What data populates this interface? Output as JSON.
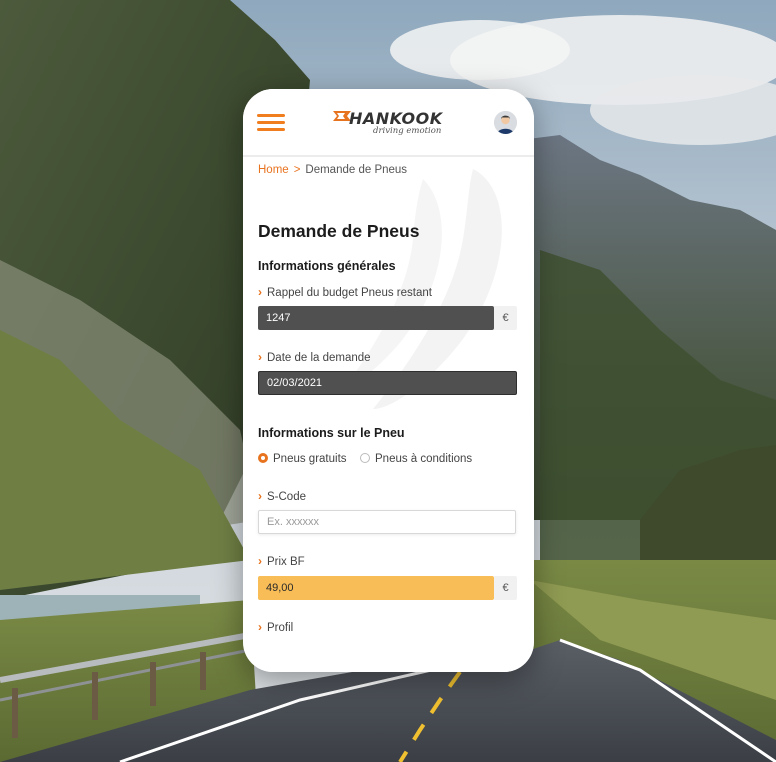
{
  "header": {
    "logo_text": "HANKOOK",
    "logo_tagline": "driving emotion"
  },
  "breadcrumb": {
    "home": "Home",
    "separator": ">",
    "current": "Demande de Pneus"
  },
  "page": {
    "title": "Demande de Pneus"
  },
  "general": {
    "title": "Informations générales",
    "budget_label": "Rappel du budget Pneus restant",
    "budget_value": "1247",
    "budget_suffix": "€",
    "date_label": "Date de la demande",
    "date_value": "02/03/2021"
  },
  "tire": {
    "title": "Informations sur le Pneu",
    "radio_options": [
      "Pneus gratuits",
      "Pneus à conditions"
    ],
    "radio_selected": "Pneus gratuits",
    "scode_label": "S-Code",
    "scode_placeholder": "Ex. xxxxxx",
    "prix_label": "Prix BF",
    "prix_value": "49,00",
    "prix_suffix": "€",
    "profil_label": "Profil"
  },
  "colors": {
    "accent": "#e8731f",
    "dark_field": "#505050",
    "highlight_field": "#f8bd57"
  },
  "icons": {
    "menu": "hamburger-icon",
    "avatar": "user-avatar-icon",
    "chevron": "chevron-right-icon",
    "logo_mark": "hankook-flag-icon"
  }
}
